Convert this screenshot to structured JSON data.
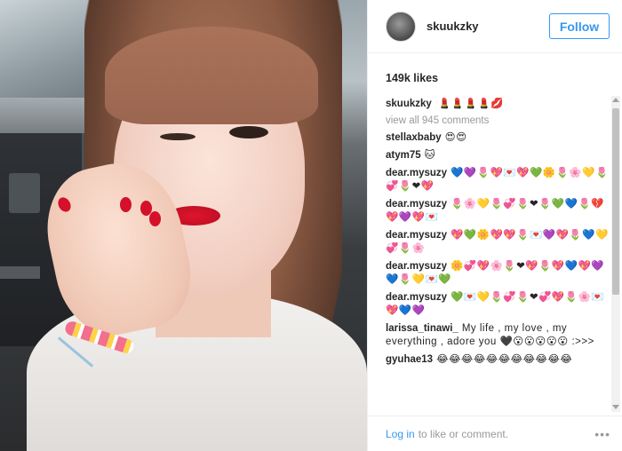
{
  "post": {
    "photo_alt": "selfie photo"
  },
  "header": {
    "username": "skuukzky",
    "follow_label": "Follow"
  },
  "likes": "149k likes",
  "caption": {
    "author": "skuukzky",
    "text": "💄💄💄💄💋"
  },
  "view_all": "view all 945 comments",
  "comments": [
    {
      "author": "stellaxbaby",
      "text": "😍😍"
    },
    {
      "author": "atym75",
      "text": "🐱"
    },
    {
      "author": "dear.mysuzy",
      "text": "💙💜🌷💖💌💖💚🌼🌷🌸💛🌷💞🌷❤💖"
    },
    {
      "author": "dear.mysuzy",
      "text": "🌷🌸💛🌷💞🌷❤🌷💚💙🌷💔💖💜💖💌"
    },
    {
      "author": "dear.mysuzy",
      "text": "💖💚🌼💖💖🌷💌💜💖🌷💙💛💞🌷🌸"
    },
    {
      "author": "dear.mysuzy",
      "text": "🌼💞💖🌸🌷❤💖🌷💖💙💖💜💙🌷💛💌💚"
    },
    {
      "author": "dear.mysuzy",
      "text": "💚💌💛🌷💞🌷❤💞💖🌷🌸💌💖💙💜"
    },
    {
      "author": "larissa_tinawi_",
      "text": "My life , my love , my everything , adore you 🖤😮😮😮😮😮 :>>>"
    },
    {
      "author": "gyuhae13",
      "text": "😂😂😂😂😂😂😂😂😂😂😂"
    }
  ],
  "footer": {
    "login_label": "Log in",
    "rest_text": "to like or comment.",
    "more_icon": "•••"
  },
  "colors": {
    "accent": "#3897f0",
    "text": "#262626",
    "muted": "#999999"
  }
}
